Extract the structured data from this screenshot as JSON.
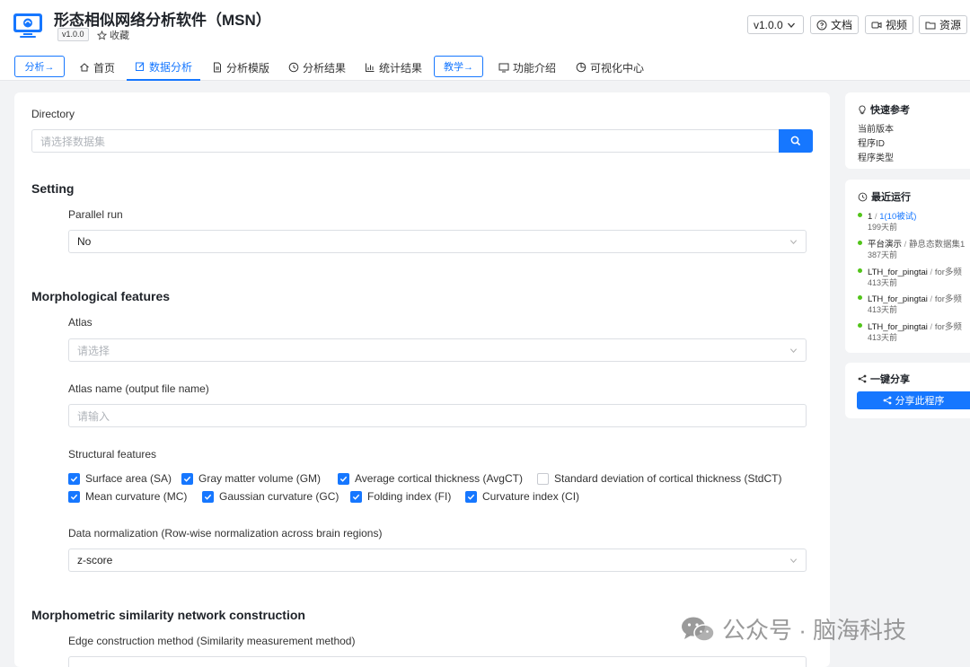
{
  "header": {
    "app_title": "形态相似网络分析软件（MSN）",
    "version_tag": "v1.0.0",
    "favorite_label": "收藏",
    "version_select": "v1.0.0",
    "docs_label": "文档",
    "video_label": "视频",
    "resources_label": "资源"
  },
  "nav": {
    "analysis_btn": "分析→",
    "home": "首页",
    "data_analysis": "数据分析",
    "templates": "分析模版",
    "results": "分析结果",
    "stats": "统计结果",
    "teaching_btn": "教学→",
    "features": "功能介绍",
    "viz_center": "可视化中心"
  },
  "form": {
    "directory_label": "Directory",
    "directory_placeholder": "请选择数据集",
    "setting_title": "Setting",
    "parallel_label": "Parallel run",
    "parallel_value": "No",
    "morph_title": "Morphological features",
    "atlas_label": "Atlas",
    "atlas_placeholder": "请选择",
    "atlas_name_label": "Atlas name (output file name)",
    "atlas_name_placeholder": "请输入",
    "structural_label": "Structural features",
    "features": [
      {
        "label": "Surface area (SA)",
        "checked": true
      },
      {
        "label": "Gray matter volume (GM)",
        "checked": true
      },
      {
        "label": "Average cortical thickness (AvgCT)",
        "checked": true
      },
      {
        "label": "Standard deviation of cortical thickness (StdCT)",
        "checked": false
      },
      {
        "label": "Mean curvature (MC)",
        "checked": true
      },
      {
        "label": "Gaussian curvature (GC)",
        "checked": true
      },
      {
        "label": "Folding index (FI)",
        "checked": true
      },
      {
        "label": "Curvature index (CI)",
        "checked": true
      }
    ],
    "normalization_label": "Data normalization (Row-wise normalization across brain regions)",
    "normalization_value": "z-score",
    "msn_title": "Morphometric similarity network construction",
    "edge_label": "Edge construction method (Similarity measurement method)"
  },
  "sidebar": {
    "quick_ref_title": "快速参考",
    "current_version": "当前版本",
    "program_id": "程序ID",
    "program_type": "程序类型",
    "recent_title": "最近运行",
    "runs": [
      {
        "name": "1",
        "sep": " / ",
        "detail": "1(10被试)",
        "time": "199天前"
      },
      {
        "name": "平台演示",
        "sep": " / ",
        "detail": "静息态数据集1",
        "time": "387天前"
      },
      {
        "name": "LTH_for_pingtai",
        "sep": " / ",
        "detail": "for多频",
        "time": "413天前"
      },
      {
        "name": "LTH_for_pingtai",
        "sep": " / ",
        "detail": "for多频",
        "time": "413天前"
      },
      {
        "name": "LTH_for_pingtai",
        "sep": " / ",
        "detail": "for多频",
        "time": "413天前"
      }
    ],
    "share_title": "一键分享",
    "share_btn": "分享此程序"
  },
  "watermark": "公众号 · 脑海科技",
  "colors": {
    "accent": "#1677ff",
    "ok": "#52c41a"
  }
}
